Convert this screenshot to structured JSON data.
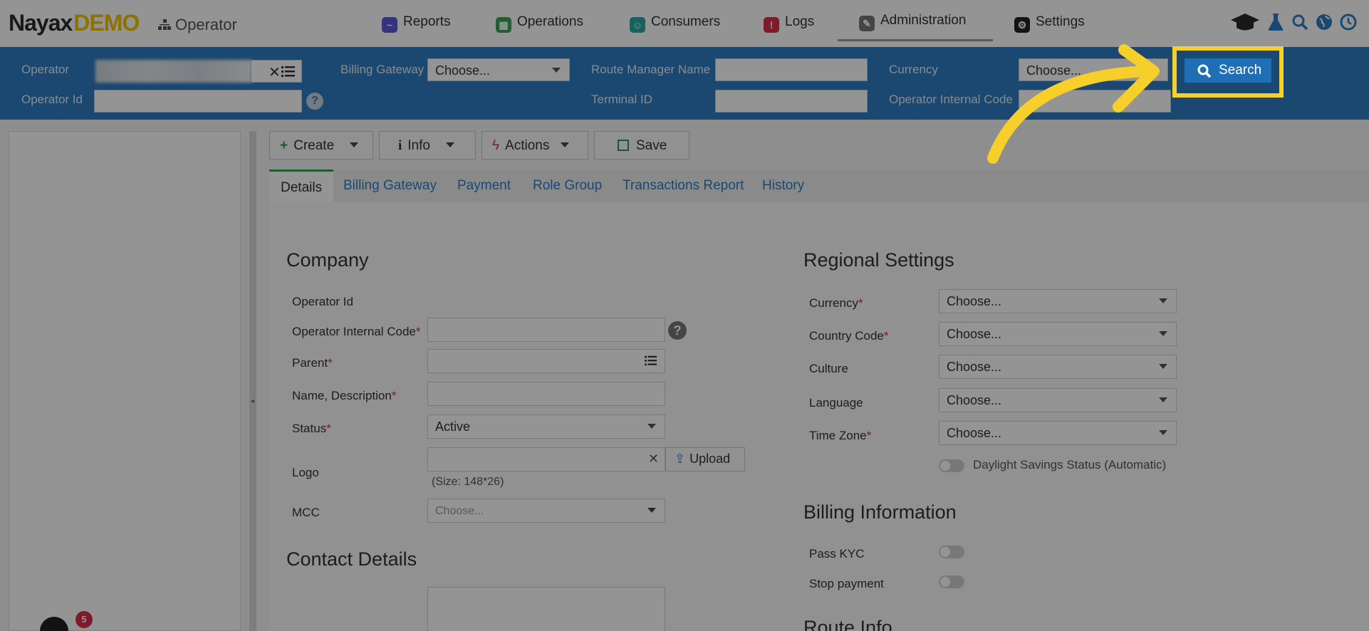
{
  "brand": {
    "name": "Nayax",
    "suffix": "DEMO",
    "section": "Operator"
  },
  "nav": [
    {
      "label": "Reports",
      "icon": "reports-icon",
      "color": "#5b5bd6"
    },
    {
      "label": "Operations",
      "icon": "operations-icon",
      "color": "#3aa35a"
    },
    {
      "label": "Consumers",
      "icon": "consumers-icon",
      "color": "#2aa7a0"
    },
    {
      "label": "Logs",
      "icon": "logs-icon",
      "color": "#d9304a"
    },
    {
      "label": "Administration",
      "icon": "administration-icon",
      "color": "#777777",
      "active": true
    },
    {
      "label": "Settings",
      "icon": "settings-icon",
      "color": "#222222"
    }
  ],
  "search": {
    "operator_label": "Operator",
    "operator_id_label": "Operator Id",
    "billing_gateway_label": "Billing Gateway",
    "billing_gateway_value": "Choose...",
    "route_manager_label": "Route Manager Name",
    "terminal_id_label": "Terminal ID",
    "currency_label": "Currency",
    "currency_value": "Choose...",
    "operator_internal_code_label": "Operator Internal Code",
    "search_button": "Search"
  },
  "toolbar": {
    "create": "Create",
    "info": "Info",
    "actions": "Actions",
    "save": "Save"
  },
  "tabs": [
    "Details",
    "Billing Gateway",
    "Payment",
    "Role Group",
    "Transactions Report",
    "History"
  ],
  "company": {
    "heading": "Company",
    "operator_id": "Operator Id",
    "operator_internal_code": "Operator Internal Code",
    "parent": "Parent",
    "name_description": "Name, Description",
    "status": "Status",
    "status_value": "Active",
    "logo": "Logo",
    "upload": "Upload",
    "logo_size": "(Size: 148*26)",
    "mcc": "MCC",
    "mcc_placeholder": "Choose...",
    "req": "*"
  },
  "contact": {
    "heading": "Contact Details"
  },
  "regional": {
    "heading": "Regional Settings",
    "currency": "Currency",
    "country_code": "Country Code",
    "culture": "Culture",
    "language": "Language",
    "time_zone": "Time Zone",
    "choose": "Choose...",
    "daylight": "Daylight Savings Status (Automatic)"
  },
  "billing": {
    "heading": "Billing Information",
    "pass_kyc": "Pass KYC",
    "stop_payment": "Stop payment"
  },
  "route": {
    "heading": "Route Info"
  },
  "notification": {
    "count": "5"
  },
  "colors": {
    "accent": "#2e7dc3",
    "highlight": "#f6cf2a",
    "brand_yellow": "#f2c400"
  }
}
